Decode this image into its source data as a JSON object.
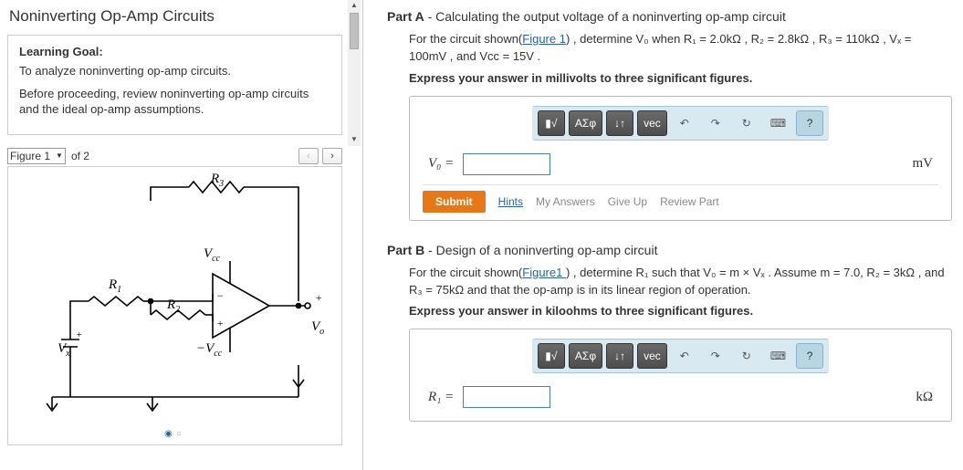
{
  "left": {
    "title": "Noninverting Op-Amp Circuits",
    "goal_hd": "Learning Goal:",
    "goal_p1": "To analyze noninverting op-amp circuits.",
    "goal_p2": "Before proceeding, review noninverting op-amp circuits and the ideal op-amp assumptions.",
    "figure_label": "Figure 1",
    "of_label": "of 2",
    "circuit": {
      "R1": "R",
      "R1s": "1",
      "R2": "R",
      "R2s": "2",
      "R3": "R",
      "R3s": "3",
      "Vcc": "V",
      "Vccs": "cc",
      "nVcc": "−V",
      "nVccs": "cc",
      "Vx": "V",
      "Vxs": "x",
      "Vo": "V",
      "Vos": "o",
      "plus": "+",
      "minus": "−",
      "oplus": "+"
    }
  },
  "partA": {
    "heading_b": "Part A",
    "heading_rest": " - Calculating the output voltage of a noninverting op-amp circuit",
    "prompt_pre": "For the circuit shown(",
    "prompt_link": "Figure 1",
    "prompt_post": ") , determine V₀ when  R₁ = 2.0kΩ ,  R₂ = 2.8kΩ ,  R₃ = 110kΩ ,  Vₓ = 100mV , and Vcc = 15V .",
    "instr": "Express your answer in millivolts to three significant figures.",
    "eq_label": "V₀  =",
    "unit": "mV",
    "submit": "Submit",
    "hints": "Hints",
    "myans": "My Answers",
    "giveup": "Give Up",
    "review": "Review Part"
  },
  "partB": {
    "heading_b": "Part B",
    "heading_rest": " - Design of a noninverting op-amp circuit",
    "prompt_pre": "For the circuit shown(",
    "prompt_link": "Figure1 ",
    "prompt_post": ") , determine R₁ such that V₀ = m × Vₓ . Assume m = 7.0,  R₂ = 3kΩ , and R₃ = 75kΩ and that the op-amp is in its linear region of operation.",
    "instr": "Express your answer in kiloohms to three significant figures.",
    "eq_label": "R₁  =",
    "unit": "kΩ"
  },
  "toolbar": {
    "tmpl": "▮√",
    "greek": "ΑΣφ",
    "updown": "↓↑",
    "vec": "vec",
    "undo": "↶",
    "redo": "↷",
    "reset": "↻",
    "kbd": "⌨",
    "help": "?"
  }
}
